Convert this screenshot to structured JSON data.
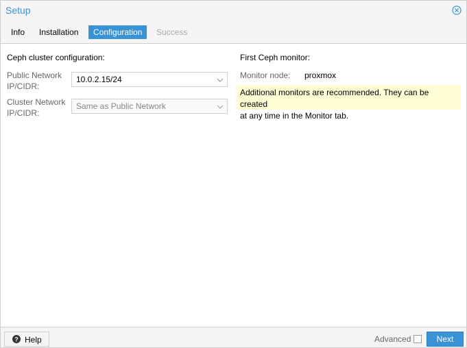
{
  "window": {
    "title": "Setup"
  },
  "tabs": [
    {
      "label": "Info",
      "state": "normal"
    },
    {
      "label": "Installation",
      "state": "normal"
    },
    {
      "label": "Configuration",
      "state": "active"
    },
    {
      "label": "Success",
      "state": "disabled"
    }
  ],
  "config": {
    "section_title": "Ceph cluster configuration:",
    "public_network": {
      "label_line1": "Public Network",
      "label_line2": "IP/CIDR:",
      "value": "10.0.2.15/24"
    },
    "cluster_network": {
      "label_line1": "Cluster Network",
      "label_line2": "IP/CIDR:",
      "value": "Same as Public Network"
    }
  },
  "monitor": {
    "section_title": "First Ceph monitor:",
    "node_label": "Monitor node:",
    "node_value": "proxmox",
    "notice_line1": "Additional monitors are recommended. They can be created",
    "notice_line2": "at any time in the Monitor tab."
  },
  "footer": {
    "help_label": "Help",
    "advanced_label": "Advanced",
    "advanced_checked": false,
    "next_label": "Next"
  },
  "colors": {
    "accent": "#3892d4",
    "notice_bg": "#fffdd6"
  },
  "icons": {
    "close": "close-circle-icon",
    "help": "question-circle-icon",
    "dropdown": "chevron-down-icon"
  }
}
